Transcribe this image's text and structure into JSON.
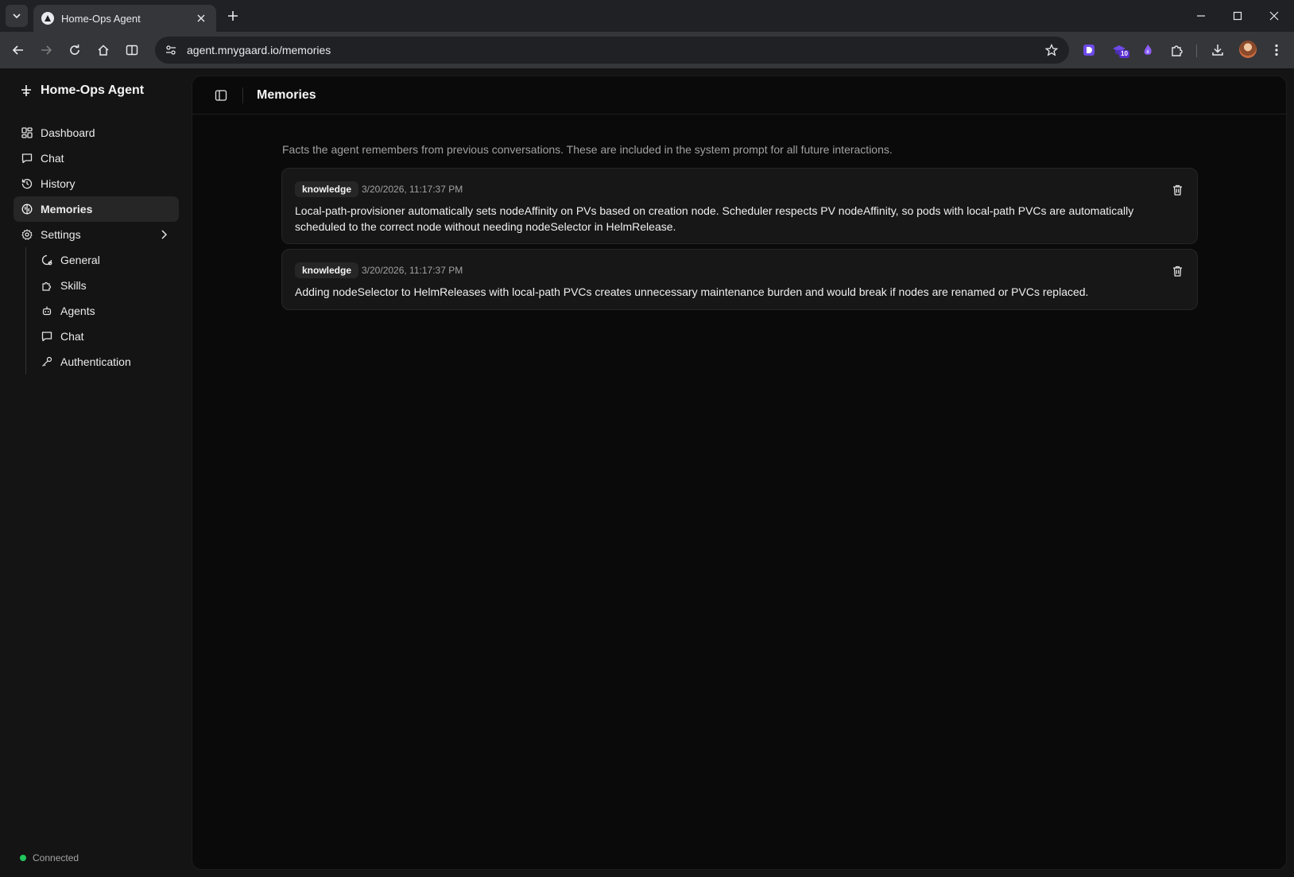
{
  "browser": {
    "tab_title": "Home-Ops Agent",
    "url": "agent.mnygaard.io/memories",
    "extension_badge": "10"
  },
  "app": {
    "brand": "Home-Ops Agent",
    "nav": [
      {
        "label": "Dashboard",
        "icon": "dashboard-icon"
      },
      {
        "label": "Chat",
        "icon": "chat-icon"
      },
      {
        "label": "History",
        "icon": "history-icon"
      },
      {
        "label": "Memories",
        "icon": "brain-icon"
      },
      {
        "label": "Settings",
        "icon": "gear-icon"
      }
    ],
    "settings_subnav": [
      {
        "label": "General",
        "icon": "settings-cog-icon"
      },
      {
        "label": "Skills",
        "icon": "puzzle-icon"
      },
      {
        "label": "Agents",
        "icon": "bot-icon"
      },
      {
        "label": "Chat",
        "icon": "chat-icon"
      },
      {
        "label": "Authentication",
        "icon": "key-icon"
      }
    ],
    "status": "Connected",
    "status_color": "#22c55e"
  },
  "page": {
    "title": "Memories",
    "description": "Facts the agent remembers from previous conversations. These are included in the system prompt for all future interactions.",
    "memories": [
      {
        "category": "knowledge",
        "timestamp": "3/20/2026, 11:17:37 PM",
        "text": "Local-path-provisioner automatically sets nodeAffinity on PVs based on creation node. Scheduler respects PV nodeAffinity, so pods with local-path PVCs are automatically scheduled to the correct node without needing nodeSelector in HelmRelease."
      },
      {
        "category": "knowledge",
        "timestamp": "3/20/2026, 11:17:37 PM",
        "text": "Adding nodeSelector to HelmReleases with local-path PVCs creates unnecessary maintenance burden and would break if nodes are renamed or PVCs replaced."
      }
    ]
  }
}
